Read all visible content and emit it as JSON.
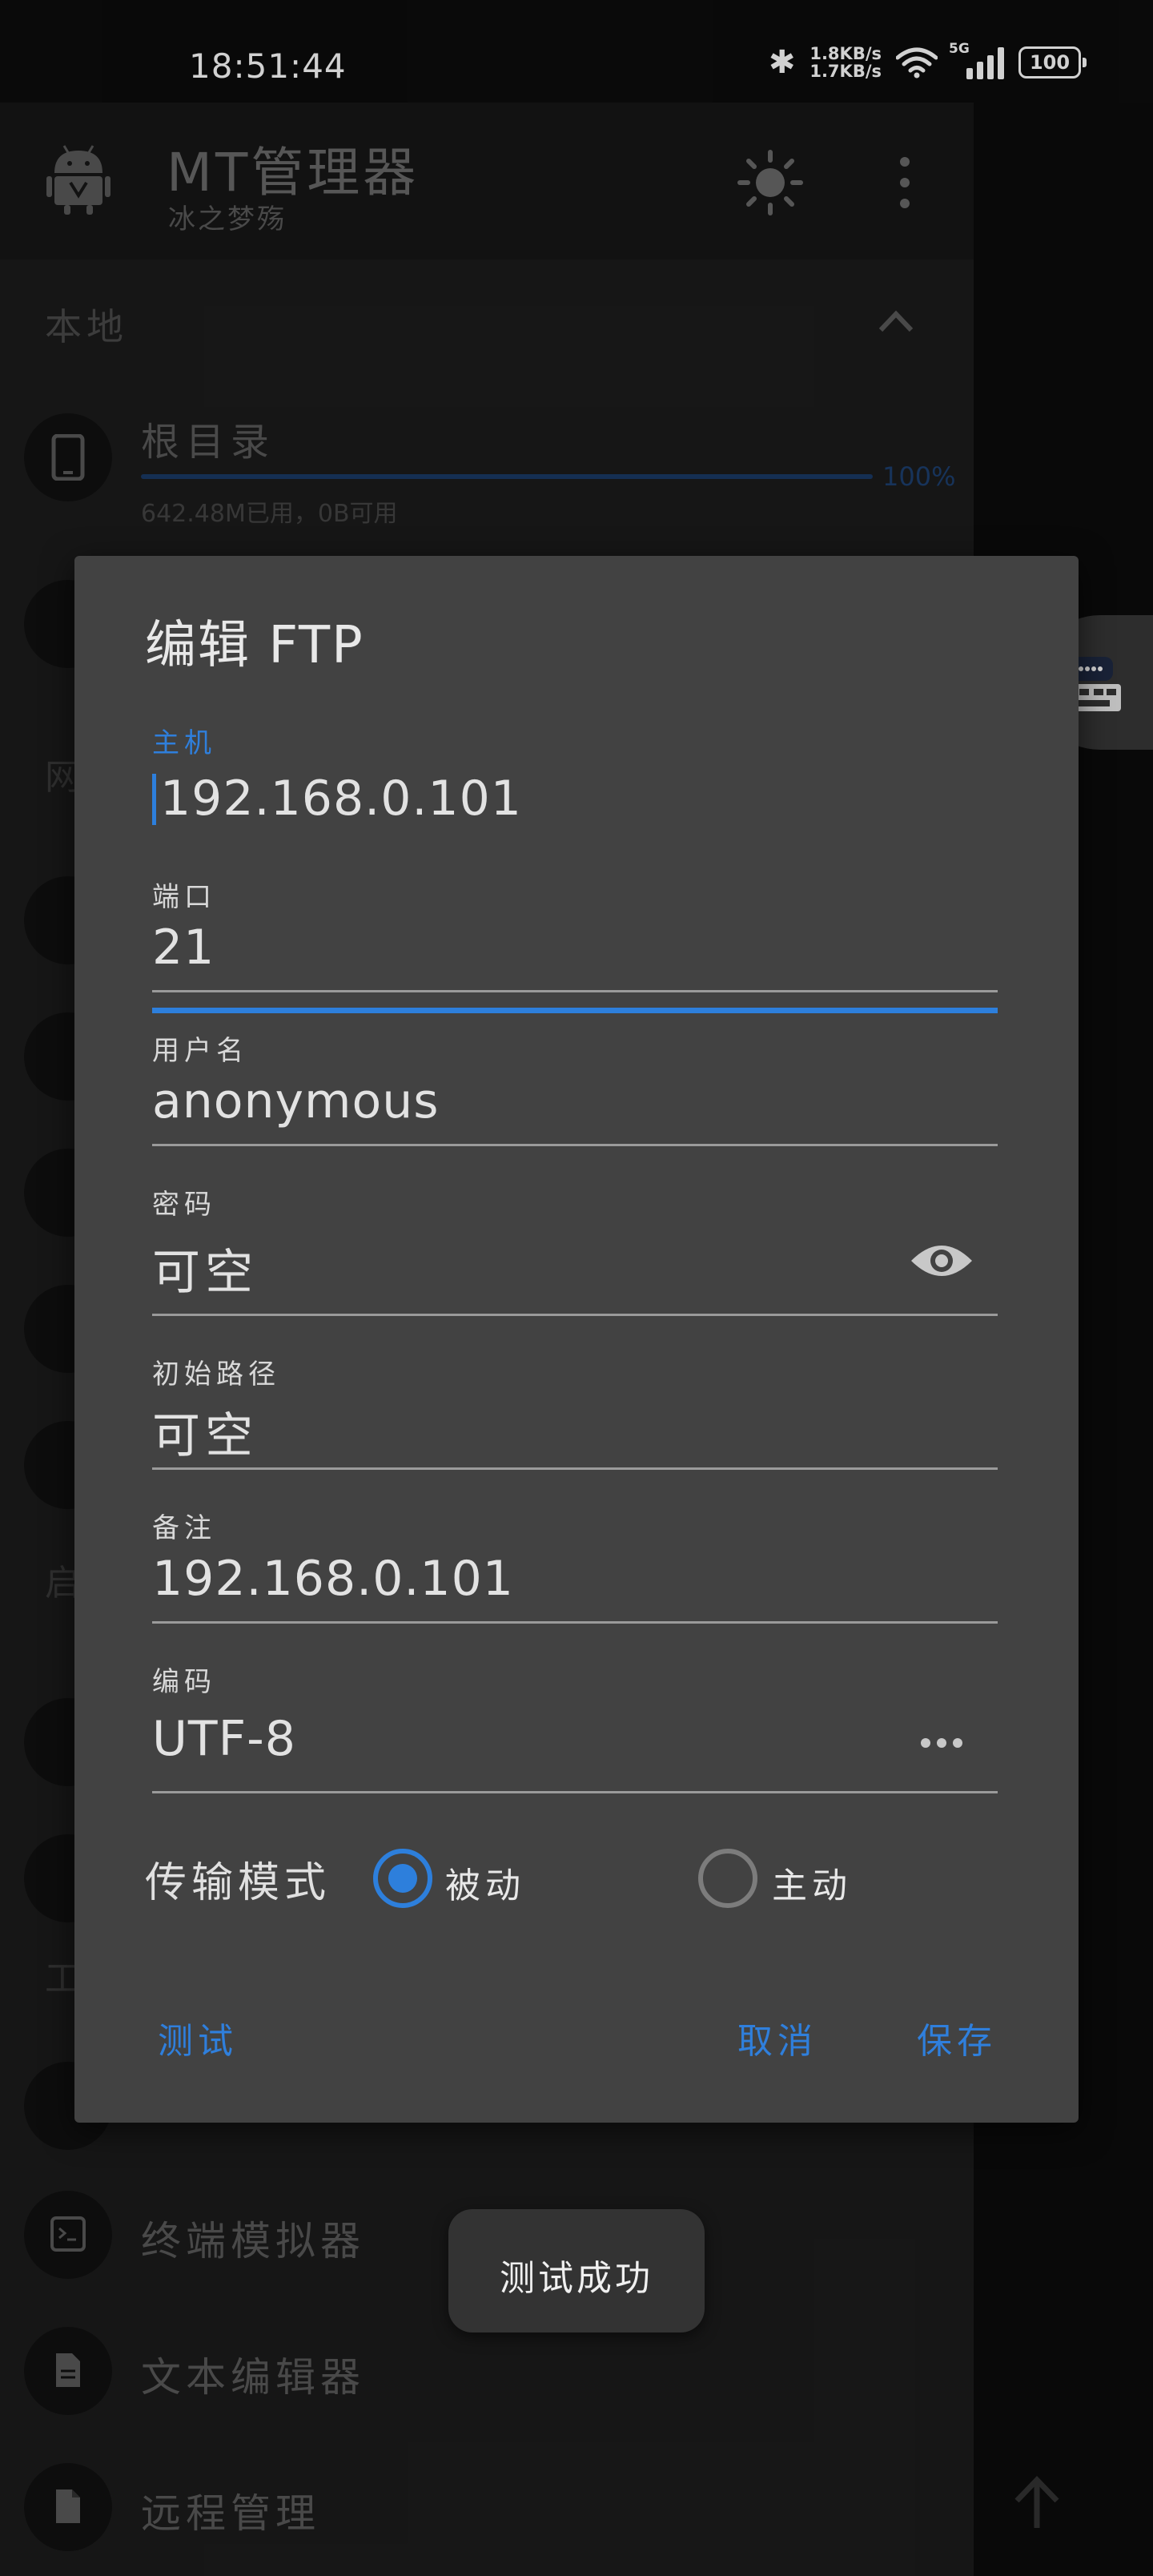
{
  "status_bar": {
    "time": "18:51:44",
    "speed_up": "1.8KB/s",
    "speed_down": "1.7KB/s",
    "network": "5G",
    "battery": "100"
  },
  "app_bar": {
    "title": "MT管理器",
    "subtitle": "冰之梦殇"
  },
  "drawer": {
    "section_local": "本地",
    "root": {
      "title": "根目录",
      "percent": "100%",
      "usage_value": 1.0,
      "usage_text": "642.48M已用，0B可用"
    },
    "section_letters": [
      "网",
      "启",
      "工"
    ],
    "tools": [
      {
        "label": "终端模拟器",
        "icon": "terminal-icon"
      },
      {
        "label": "文本编辑器",
        "icon": "document-icon"
      },
      {
        "label": "远程管理",
        "icon": "file-icon"
      }
    ]
  },
  "dialog": {
    "title": "编辑 FTP",
    "fields": {
      "host": {
        "label": "主机",
        "value": "192.168.0.101"
      },
      "port": {
        "label": "端口",
        "value": "21"
      },
      "username": {
        "label": "用户名",
        "value": "anonymous"
      },
      "password": {
        "label": "密码",
        "placeholder": "可空"
      },
      "init_path": {
        "label": "初始路径",
        "placeholder": "可空"
      },
      "remark": {
        "label": "备注",
        "value": "192.168.0.101"
      },
      "encoding": {
        "label": "编码",
        "value": "UTF-8"
      }
    },
    "transfer_mode": {
      "label": "传输模式",
      "options": [
        {
          "label": "被动",
          "selected": true
        },
        {
          "label": "主动",
          "selected": false
        }
      ]
    },
    "buttons": {
      "test": "测试",
      "cancel": "取消",
      "save": "保存"
    }
  },
  "toast": "测试成功",
  "colors": {
    "accent": "#2d7fdc",
    "dialog_bg": "#424242",
    "background": "#1c1c1c"
  }
}
